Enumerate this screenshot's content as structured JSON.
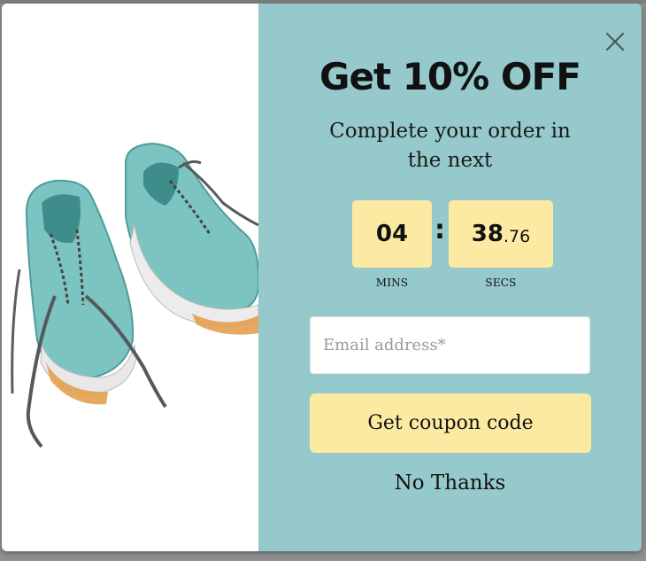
{
  "popup": {
    "title": "Get 10% OFF",
    "subtitle": "Complete your order in the next",
    "timer": {
      "mins": "04",
      "secs_whole": "38",
      "secs_frac": ".76",
      "separator": ":",
      "mins_label": "MINS",
      "secs_label": "SECS"
    },
    "email": {
      "value": "",
      "placeholder": "Email address*"
    },
    "submit_label": "Get coupon code",
    "dismiss_label": "No Thanks",
    "close_icon": "close-icon",
    "image": "sneakers-illustration"
  },
  "colors": {
    "panel_bg": "#95c9cb",
    "accent_yellow": "#fdeaa2",
    "backdrop": "#8f8f8f",
    "sneaker_teal": "#7cc4c1"
  }
}
